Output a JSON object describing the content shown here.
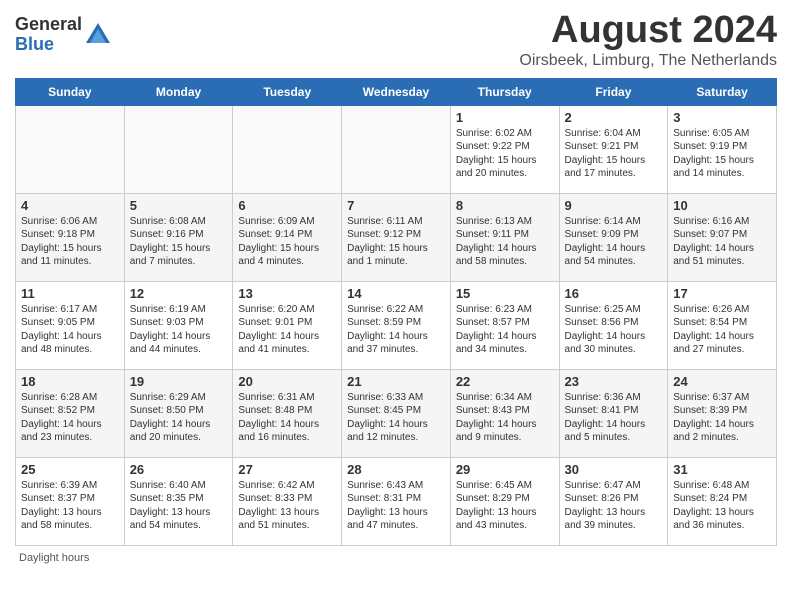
{
  "header": {
    "logo_general": "General",
    "logo_blue": "Blue",
    "month_title": "August 2024",
    "subtitle": "Oirsbeek, Limburg, The Netherlands"
  },
  "days_of_week": [
    "Sunday",
    "Monday",
    "Tuesday",
    "Wednesday",
    "Thursday",
    "Friday",
    "Saturday"
  ],
  "weeks": [
    [
      {
        "day": "",
        "info": ""
      },
      {
        "day": "",
        "info": ""
      },
      {
        "day": "",
        "info": ""
      },
      {
        "day": "",
        "info": ""
      },
      {
        "day": "1",
        "info": "Sunrise: 6:02 AM\nSunset: 9:22 PM\nDaylight: 15 hours and 20 minutes."
      },
      {
        "day": "2",
        "info": "Sunrise: 6:04 AM\nSunset: 9:21 PM\nDaylight: 15 hours and 17 minutes."
      },
      {
        "day": "3",
        "info": "Sunrise: 6:05 AM\nSunset: 9:19 PM\nDaylight: 15 hours and 14 minutes."
      }
    ],
    [
      {
        "day": "4",
        "info": "Sunrise: 6:06 AM\nSunset: 9:18 PM\nDaylight: 15 hours and 11 minutes."
      },
      {
        "day": "5",
        "info": "Sunrise: 6:08 AM\nSunset: 9:16 PM\nDaylight: 15 hours and 7 minutes."
      },
      {
        "day": "6",
        "info": "Sunrise: 6:09 AM\nSunset: 9:14 PM\nDaylight: 15 hours and 4 minutes."
      },
      {
        "day": "7",
        "info": "Sunrise: 6:11 AM\nSunset: 9:12 PM\nDaylight: 15 hours and 1 minute."
      },
      {
        "day": "8",
        "info": "Sunrise: 6:13 AM\nSunset: 9:11 PM\nDaylight: 14 hours and 58 minutes."
      },
      {
        "day": "9",
        "info": "Sunrise: 6:14 AM\nSunset: 9:09 PM\nDaylight: 14 hours and 54 minutes."
      },
      {
        "day": "10",
        "info": "Sunrise: 6:16 AM\nSunset: 9:07 PM\nDaylight: 14 hours and 51 minutes."
      }
    ],
    [
      {
        "day": "11",
        "info": "Sunrise: 6:17 AM\nSunset: 9:05 PM\nDaylight: 14 hours and 48 minutes."
      },
      {
        "day": "12",
        "info": "Sunrise: 6:19 AM\nSunset: 9:03 PM\nDaylight: 14 hours and 44 minutes."
      },
      {
        "day": "13",
        "info": "Sunrise: 6:20 AM\nSunset: 9:01 PM\nDaylight: 14 hours and 41 minutes."
      },
      {
        "day": "14",
        "info": "Sunrise: 6:22 AM\nSunset: 8:59 PM\nDaylight: 14 hours and 37 minutes."
      },
      {
        "day": "15",
        "info": "Sunrise: 6:23 AM\nSunset: 8:57 PM\nDaylight: 14 hours and 34 minutes."
      },
      {
        "day": "16",
        "info": "Sunrise: 6:25 AM\nSunset: 8:56 PM\nDaylight: 14 hours and 30 minutes."
      },
      {
        "day": "17",
        "info": "Sunrise: 6:26 AM\nSunset: 8:54 PM\nDaylight: 14 hours and 27 minutes."
      }
    ],
    [
      {
        "day": "18",
        "info": "Sunrise: 6:28 AM\nSunset: 8:52 PM\nDaylight: 14 hours and 23 minutes."
      },
      {
        "day": "19",
        "info": "Sunrise: 6:29 AM\nSunset: 8:50 PM\nDaylight: 14 hours and 20 minutes."
      },
      {
        "day": "20",
        "info": "Sunrise: 6:31 AM\nSunset: 8:48 PM\nDaylight: 14 hours and 16 minutes."
      },
      {
        "day": "21",
        "info": "Sunrise: 6:33 AM\nSunset: 8:45 PM\nDaylight: 14 hours and 12 minutes."
      },
      {
        "day": "22",
        "info": "Sunrise: 6:34 AM\nSunset: 8:43 PM\nDaylight: 14 hours and 9 minutes."
      },
      {
        "day": "23",
        "info": "Sunrise: 6:36 AM\nSunset: 8:41 PM\nDaylight: 14 hours and 5 minutes."
      },
      {
        "day": "24",
        "info": "Sunrise: 6:37 AM\nSunset: 8:39 PM\nDaylight: 14 hours and 2 minutes."
      }
    ],
    [
      {
        "day": "25",
        "info": "Sunrise: 6:39 AM\nSunset: 8:37 PM\nDaylight: 13 hours and 58 minutes."
      },
      {
        "day": "26",
        "info": "Sunrise: 6:40 AM\nSunset: 8:35 PM\nDaylight: 13 hours and 54 minutes."
      },
      {
        "day": "27",
        "info": "Sunrise: 6:42 AM\nSunset: 8:33 PM\nDaylight: 13 hours and 51 minutes."
      },
      {
        "day": "28",
        "info": "Sunrise: 6:43 AM\nSunset: 8:31 PM\nDaylight: 13 hours and 47 minutes."
      },
      {
        "day": "29",
        "info": "Sunrise: 6:45 AM\nSunset: 8:29 PM\nDaylight: 13 hours and 43 minutes."
      },
      {
        "day": "30",
        "info": "Sunrise: 6:47 AM\nSunset: 8:26 PM\nDaylight: 13 hours and 39 minutes."
      },
      {
        "day": "31",
        "info": "Sunrise: 6:48 AM\nSunset: 8:24 PM\nDaylight: 13 hours and 36 minutes."
      }
    ]
  ],
  "footer": {
    "note": "Daylight hours"
  }
}
